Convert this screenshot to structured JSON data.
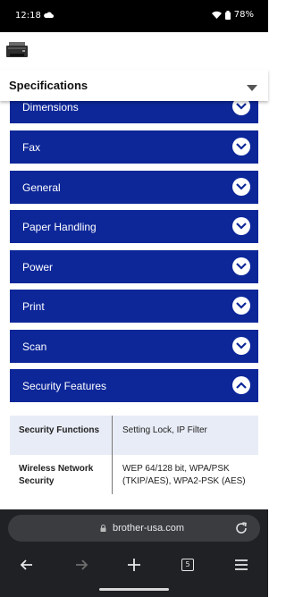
{
  "status_bar": {
    "time": "12:18",
    "battery": "78%"
  },
  "specifications": {
    "title": "Specifications"
  },
  "panels": [
    {
      "label": "Dimensions",
      "expanded": false
    },
    {
      "label": "Fax",
      "expanded": false
    },
    {
      "label": "General",
      "expanded": false
    },
    {
      "label": "Paper Handling",
      "expanded": false
    },
    {
      "label": "Power",
      "expanded": false
    },
    {
      "label": "Print",
      "expanded": false
    },
    {
      "label": "Scan",
      "expanded": false
    },
    {
      "label": "Security Features",
      "expanded": true
    }
  ],
  "security_table": [
    {
      "key": "Security Functions",
      "value": "Setting Lock, IP Filter"
    },
    {
      "key": "Wireless Network Security",
      "value": "WEP 64/128 bit, WPA/PSK (TKIP/AES), WPA2-PSK (AES)"
    }
  ],
  "browser": {
    "url": "brother-usa.com",
    "tab_count": "5"
  },
  "colors": {
    "panel_blue": "#0d2799",
    "table_row_tint": "#e8ecf6",
    "browser_bar": "#1f2124"
  }
}
